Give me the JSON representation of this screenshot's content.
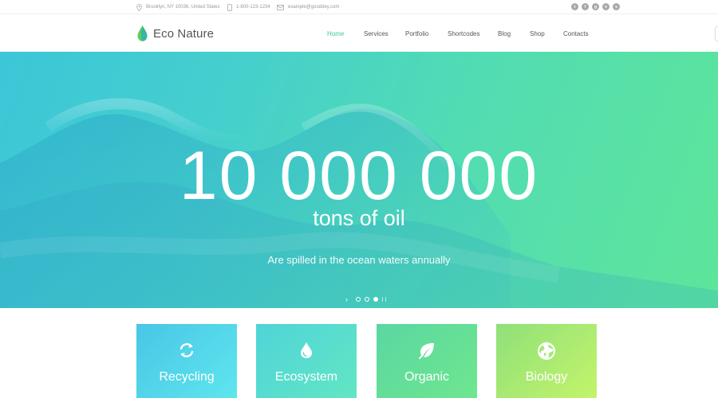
{
  "topbar": {
    "address": "Brooklyn, NY 10036, United States",
    "phone": "1-800-123-1234",
    "email": "example@gooddey.com",
    "socials": [
      {
        "icon": "twitter-icon",
        "glyph": "t"
      },
      {
        "icon": "facebook-icon",
        "glyph": "f"
      },
      {
        "icon": "google-plus-icon",
        "glyph": "g"
      },
      {
        "icon": "vimeo-icon",
        "glyph": "v"
      },
      {
        "icon": "skype-icon",
        "glyph": "s"
      }
    ]
  },
  "header": {
    "logo_text": "Eco Nature",
    "nav": [
      "Home",
      "Services",
      "Portfolio",
      "Shortcodes",
      "Blog",
      "Shop",
      "Contacts"
    ],
    "active_nav": "Home"
  },
  "hero": {
    "number": "10 000 000",
    "subtitle": "tons of oil",
    "caption": "Are spilled in the ocean waters annually",
    "slides": 3,
    "active_slide": 3
  },
  "features": [
    {
      "label": "Recycling",
      "icon": "recycle-icon"
    },
    {
      "label": "Ecosystem",
      "icon": "water-drop-icon"
    },
    {
      "label": "Organic",
      "icon": "leaf-icon"
    },
    {
      "label": "Biology",
      "icon": "globe-icon"
    }
  ],
  "colors": {
    "accent": "#3dc99a",
    "hero_start": "#3cc6d8",
    "hero_end": "#5ee59a"
  }
}
